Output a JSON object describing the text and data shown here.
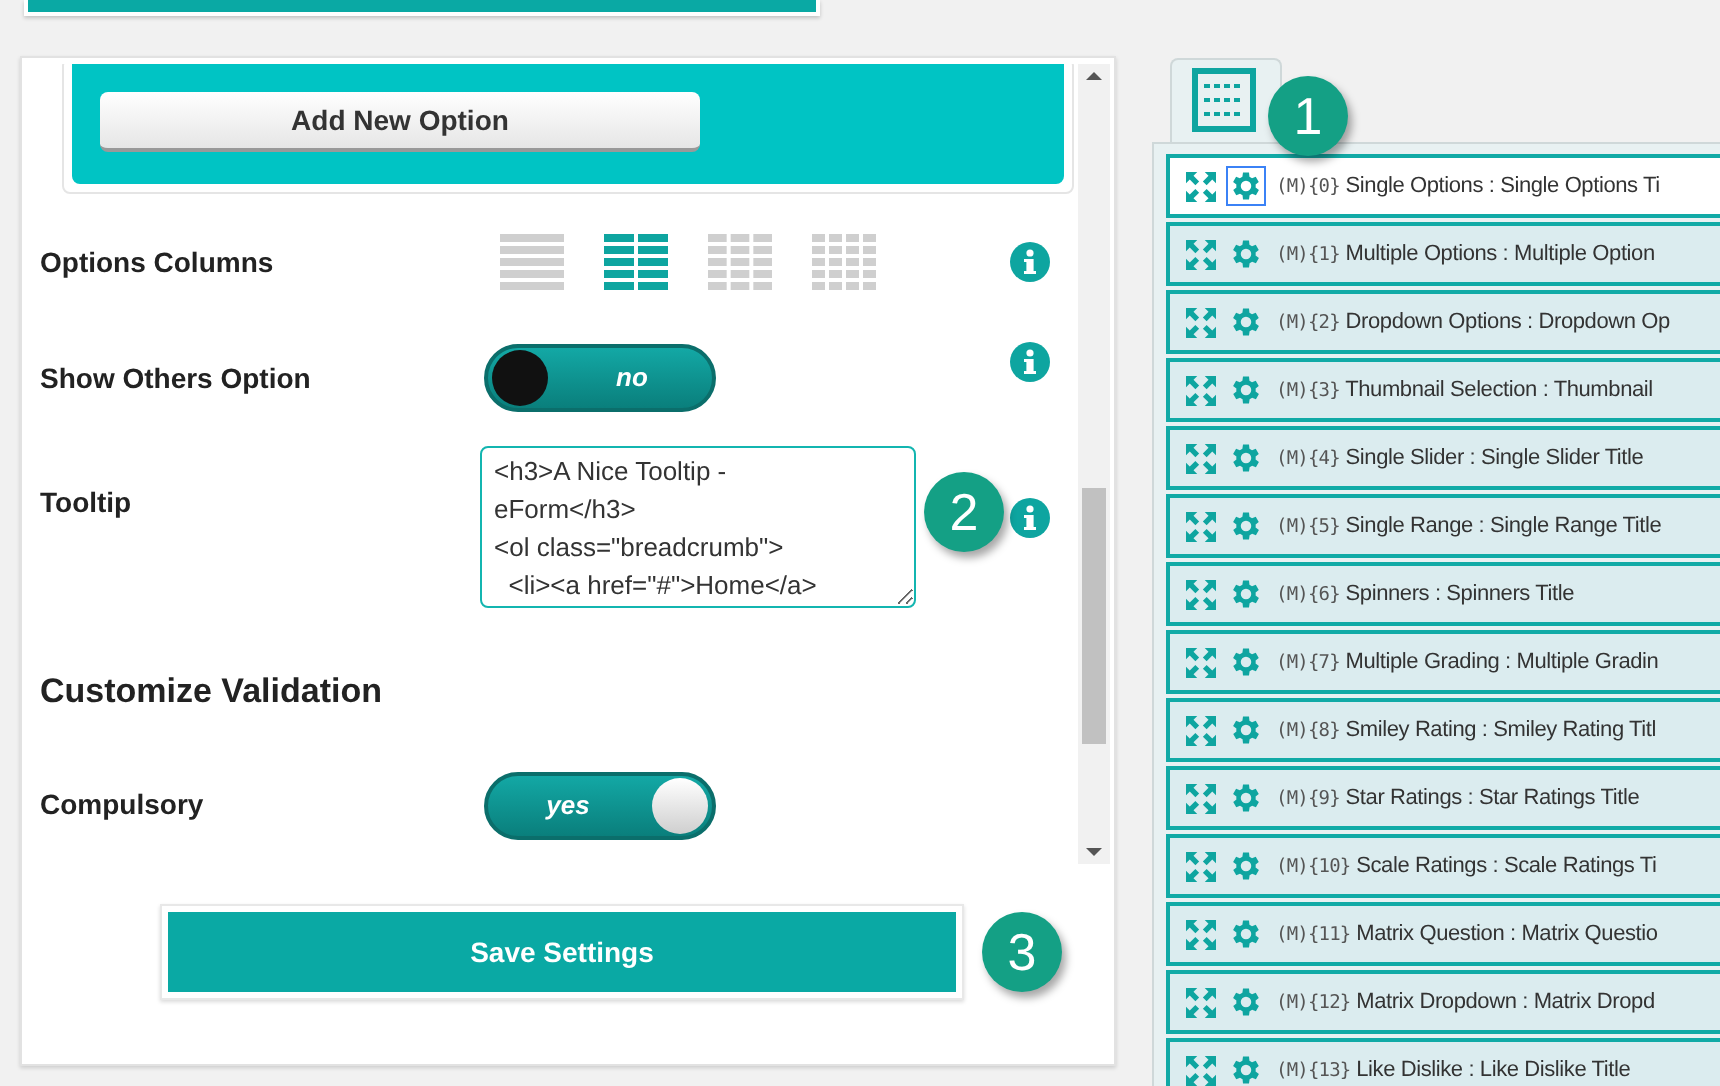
{
  "settings": {
    "add_button": "Add New Option",
    "options_columns": {
      "label": "Options Columns",
      "choices": [
        {
          "selected": false
        },
        {
          "selected": true
        },
        {
          "selected": false
        },
        {
          "selected": false
        }
      ]
    },
    "show_others": {
      "label": "Show Others Option",
      "on": false,
      "text": "no"
    },
    "tooltip": {
      "label": "Tooltip",
      "value": "<h3>A Nice Tooltip -\neForm</h3>\n<ol class=\"breadcrumb\">\n  <li><a href=\"#\">Home</a>"
    },
    "section_title": "Customize Validation",
    "compulsory": {
      "label": "Compulsory",
      "on": true,
      "text": "yes"
    },
    "save_button": "Save Settings"
  },
  "callouts": [
    "1",
    "2",
    "3"
  ],
  "elements": [
    {
      "code": "(M){0}",
      "label": "Single Options : Single Options Ti",
      "selected": true
    },
    {
      "code": "(M){1}",
      "label": "Multiple Options : Multiple Option",
      "selected": false
    },
    {
      "code": "(M){2}",
      "label": "Dropdown Options : Dropdown Op",
      "selected": false
    },
    {
      "code": "(M){3}",
      "label": "Thumbnail Selection : Thumbnail",
      "selected": false
    },
    {
      "code": "(M){4}",
      "label": "Single Slider : Single Slider Title",
      "selected": false
    },
    {
      "code": "(M){5}",
      "label": "Single Range : Single Range Title",
      "selected": false
    },
    {
      "code": "(M){6}",
      "label": "Spinners : Spinners Title",
      "selected": false
    },
    {
      "code": "(M){7}",
      "label": "Multiple Grading : Multiple Gradin",
      "selected": false
    },
    {
      "code": "(M){8}",
      "label": "Smiley Rating : Smiley Rating Titl",
      "selected": false
    },
    {
      "code": "(M){9}",
      "label": "Star Ratings : Star Ratings Title",
      "selected": false
    },
    {
      "code": "(M){10}",
      "label": "Scale Ratings : Scale Ratings Ti",
      "selected": false
    },
    {
      "code": "(M){11}",
      "label": "Matrix Question : Matrix Questio",
      "selected": false
    },
    {
      "code": "(M){12}",
      "label": "Matrix Dropdown : Matrix Dropd",
      "selected": false
    },
    {
      "code": "(M){13}",
      "label": "Like Dislike : Like Dislike Title",
      "selected": false
    }
  ]
}
